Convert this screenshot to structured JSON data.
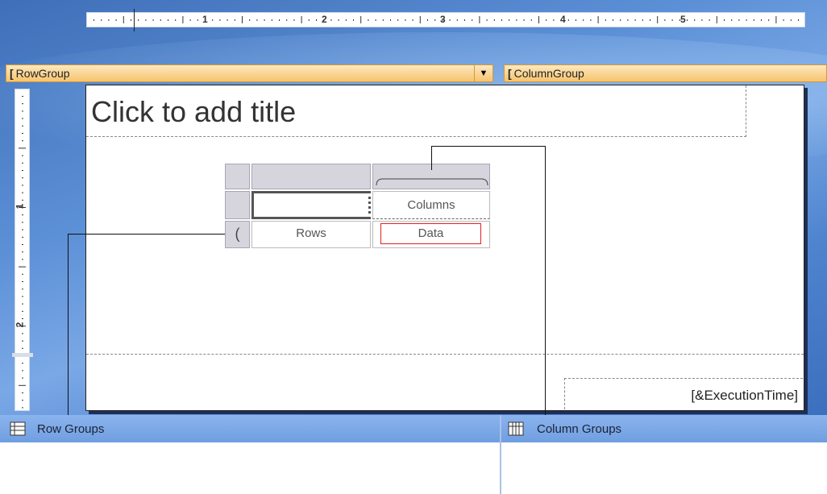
{
  "ruler": {
    "horizontal_numbers": [
      "1",
      "2",
      "3",
      "4",
      "5"
    ],
    "vertical_numbers": [
      "1",
      "2"
    ]
  },
  "report": {
    "title_placeholder": "Click to add title",
    "execution_time": "[&ExecutionTime]"
  },
  "matrix": {
    "columns_label": "Columns",
    "rows_label": "Rows",
    "data_label": "Data"
  },
  "groups": {
    "row_groups_title": "Row Groups",
    "column_groups_title": "Column Groups",
    "row_group_name": "RowGroup",
    "column_group_name": "ColumnGroup"
  }
}
